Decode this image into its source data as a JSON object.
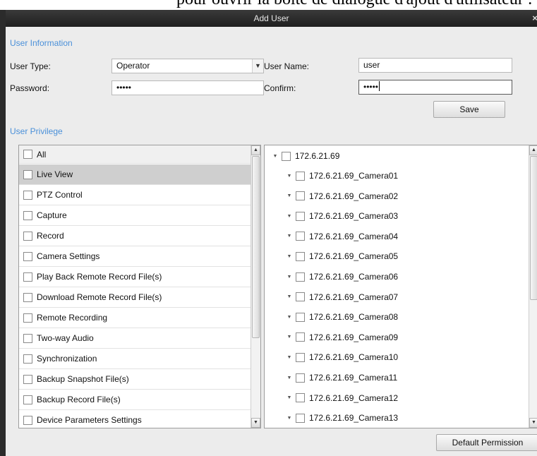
{
  "doc": {
    "caption": "pour ouvrir la boîte de dialogue d'ajout d'utilisateur :"
  },
  "dialog": {
    "title": "Add User",
    "close_glyph": "×"
  },
  "user_info": {
    "heading": "User Information",
    "user_type_label": "User Type:",
    "user_type_value": "Operator",
    "user_name_label": "User Name:",
    "user_name_value": "user",
    "password_label": "Password:",
    "password_value": "•••••",
    "confirm_label": "Confirm:",
    "confirm_value": "•••••",
    "save_label": "Save"
  },
  "privilege": {
    "heading": "User Privilege",
    "all_label": "All",
    "items": [
      {
        "label": "Live View",
        "selected": true
      },
      {
        "label": "PTZ Control",
        "selected": false
      },
      {
        "label": "Capture",
        "selected": false
      },
      {
        "label": "Record",
        "selected": false
      },
      {
        "label": "Camera Settings",
        "selected": false
      },
      {
        "label": "Play Back Remote Record File(s)",
        "selected": false
      },
      {
        "label": "Download Remote Record File(s)",
        "selected": false
      },
      {
        "label": "Remote Recording",
        "selected": false
      },
      {
        "label": "Two-way Audio",
        "selected": false
      },
      {
        "label": "Synchronization",
        "selected": false
      },
      {
        "label": "Backup Snapshot File(s)",
        "selected": false
      },
      {
        "label": "Backup Record File(s)",
        "selected": false
      },
      {
        "label": "Device Parameters Settings",
        "selected": false
      }
    ]
  },
  "devices": {
    "root": "172.6.21.69",
    "cameras": [
      "172.6.21.69_Camera01",
      "172.6.21.69_Camera02",
      "172.6.21.69_Camera03",
      "172.6.21.69_Camera04",
      "172.6.21.69_Camera05",
      "172.6.21.69_Camera06",
      "172.6.21.69_Camera07",
      "172.6.21.69_Camera08",
      "172.6.21.69_Camera09",
      "172.6.21.69_Camera10",
      "172.6.21.69_Camera11",
      "172.6.21.69_Camera12",
      "172.6.21.69_Camera13"
    ]
  },
  "footer": {
    "default_permission_label": "Default Permission"
  },
  "icons": {
    "dropdown": "chevron-down-icon",
    "expand": "expand-triangle-icon",
    "scroll_up": "scroll-up-arrow-icon",
    "scroll_down": "scroll-down-arrow-icon"
  },
  "colors": {
    "section_heading": "#4a90d9",
    "titlebar": "#2b2b2b",
    "selected_row": "#cfcfcf"
  }
}
